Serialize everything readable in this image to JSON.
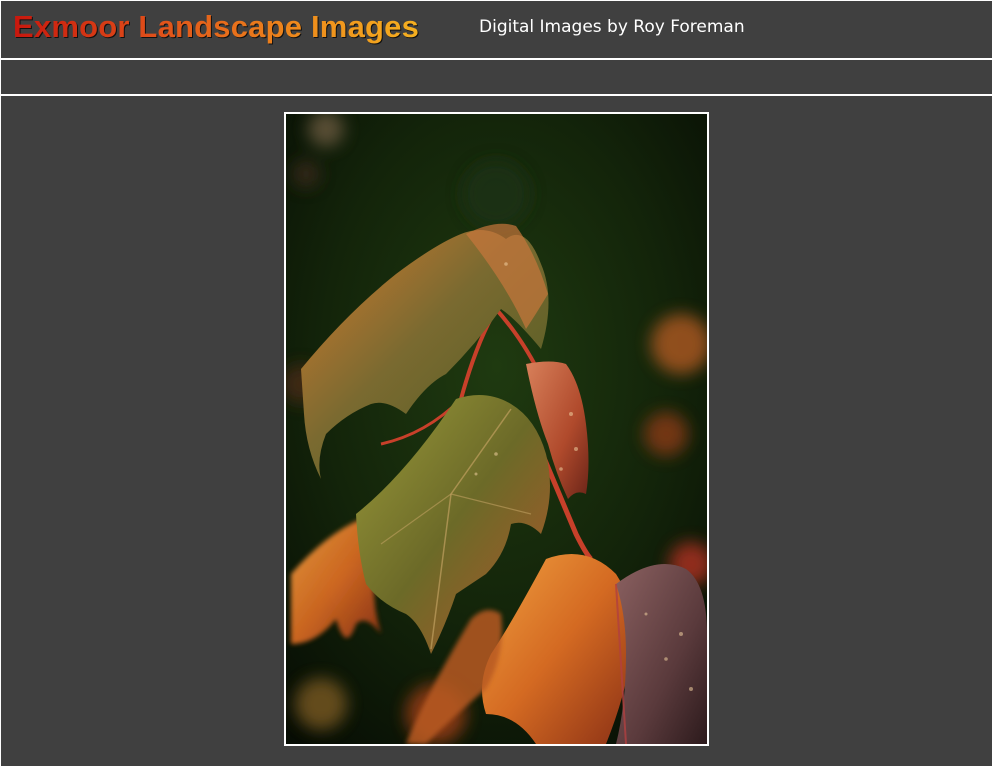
{
  "header": {
    "title": "Exmoor Landscape Images",
    "subtitle": "Digital Images by Roy Foreman"
  },
  "photo": {
    "subject": "autumn-leaves-photo"
  },
  "colors": {
    "page_background": "#404040",
    "border": "#ffffff",
    "title_gradient_start": "#c8170d",
    "title_gradient_end": "#f5b020",
    "subtitle_text": "#ffffff"
  }
}
